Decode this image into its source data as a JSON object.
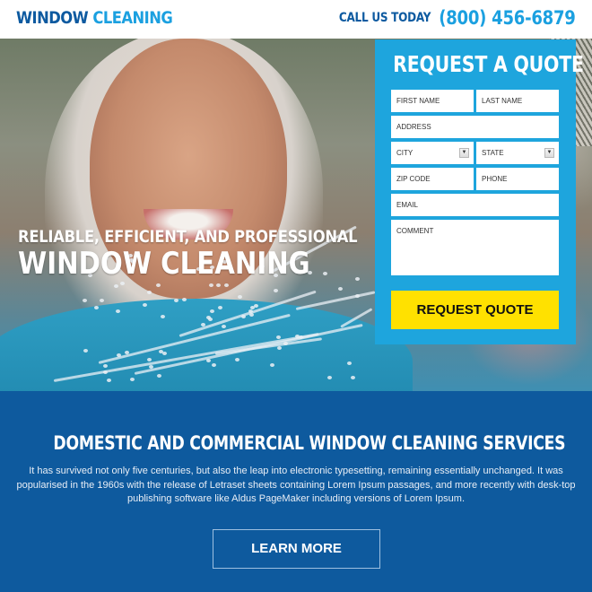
{
  "header": {
    "logo_part1": "WINDOW",
    "logo_part2": "CLEANING",
    "call_label": "CALL US TODAY",
    "phone": "(800) 456-6879"
  },
  "hero": {
    "tagline_line1": "RELIABLE, EFFICIENT, AND PROFESSIONAL",
    "tagline_line2": "WINDOW CLEANING"
  },
  "quote_form": {
    "title": "REQUEST A QUOTE",
    "fields": {
      "first_name": "FIRST NAME",
      "last_name": "LAST NAME",
      "address": "ADDRESS",
      "city": "CITY",
      "state": "STATE",
      "zip": "ZIP CODE",
      "phone": "PHONE",
      "email": "EMAIL",
      "comment": "COMMENT"
    },
    "submit_label": "REQUEST QUOTE"
  },
  "services": {
    "heading": "DOMESTIC AND COMMERCIAL WINDOW CLEANING SERVICES",
    "body": "It has survived not only five centuries, but also the leap into electronic typesetting, remaining essentially unchanged. It was popularised in the 1960s with the release of Letraset sheets containing Lorem Ipsum passages, and more recently with desk-top publishing software like Aldus PageMaker including versions of Lorem Ipsum.",
    "button_label": "LEARN MORE"
  },
  "colors": {
    "brand_dark": "#0d5aa0",
    "brand_light": "#1ba0e0",
    "form_bg": "#1ea5dd",
    "cta_yellow": "#ffe100",
    "footer_bg": "#0e5a9e"
  }
}
